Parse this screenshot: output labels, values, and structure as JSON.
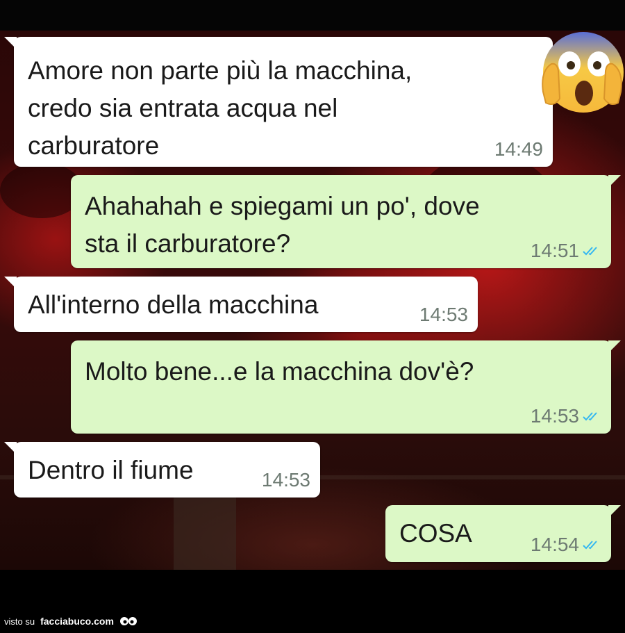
{
  "colors": {
    "incoming_bubble": "#ffffff",
    "outgoing_bubble": "#dcf8c6",
    "timestamp": "#6d7a72",
    "read_ticks": "#34b7f1",
    "background": "#3a0a0a"
  },
  "emoji": {
    "icon": "face-screaming-in-fear-icon"
  },
  "messages": [
    {
      "direction": "in",
      "text": "Amore non parte più la macchina,\ncredo sia entrata acqua nel\ncarburatore",
      "time": "14:49"
    },
    {
      "direction": "out",
      "text": "Ahahahah e spiegami un po', dove\nsta il carburatore?",
      "time": "14:51",
      "status": "read-ticks-icon"
    },
    {
      "direction": "in",
      "text": "All'interno della macchina",
      "time": "14:53"
    },
    {
      "direction": "out",
      "text": "Molto bene...e la macchina dov'è?",
      "time": "14:53",
      "status": "read-ticks-icon"
    },
    {
      "direction": "in",
      "text": "Dentro il fiume",
      "time": "14:53"
    },
    {
      "direction": "out",
      "text": "COSA",
      "time": "14:54",
      "status": "read-ticks-icon"
    }
  ],
  "footer": {
    "prefix": "visto su",
    "brand": "facciabuco.com"
  }
}
